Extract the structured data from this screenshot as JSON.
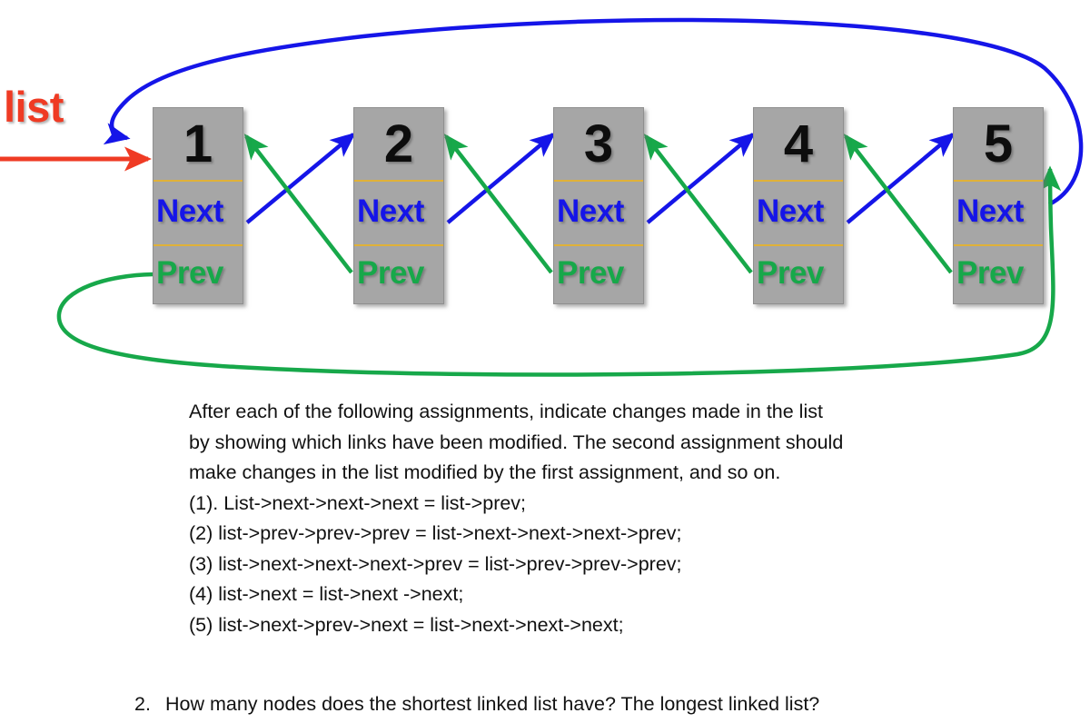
{
  "diagram": {
    "pointer_label": "list",
    "pointer_color": "#ef3b24",
    "next_color": "#1515e8",
    "prev_color": "#17a84a",
    "node_fill": "#a6a6a6",
    "divider_color": "#e0b138",
    "nodes": [
      {
        "value": "1",
        "next_label": "Next",
        "prev_label": "Prev"
      },
      {
        "value": "2",
        "next_label": "Next",
        "prev_label": "Prev"
      },
      {
        "value": "3",
        "next_label": "Next",
        "prev_label": "Prev"
      },
      {
        "value": "4",
        "next_label": "Next",
        "prev_label": "Prev"
      },
      {
        "value": "5",
        "next_label": "Next",
        "prev_label": "Prev"
      }
    ]
  },
  "prose": {
    "paragraph_line_1": "After each of the following assignments, indicate changes made in the list",
    "paragraph_line_2": "by showing which links have been modified. The second assignment should",
    "paragraph_line_3": "make changes in the list modified by the first assignment, and so on.",
    "assignments": [
      "(1). List->next->next->next = list->prev;",
      "(2)  list->prev->prev->prev = list->next->next->next->prev;",
      "(3)  list->next->next->next->prev = list->prev->prev->prev;",
      "(4)  list->next = list->next ->next;",
      "(5)  list->next->prev->next = list->next->next->next;"
    ]
  },
  "question": {
    "number": "2.",
    "text": "How many nodes does the shortest linked list have? The longest linked list?"
  }
}
